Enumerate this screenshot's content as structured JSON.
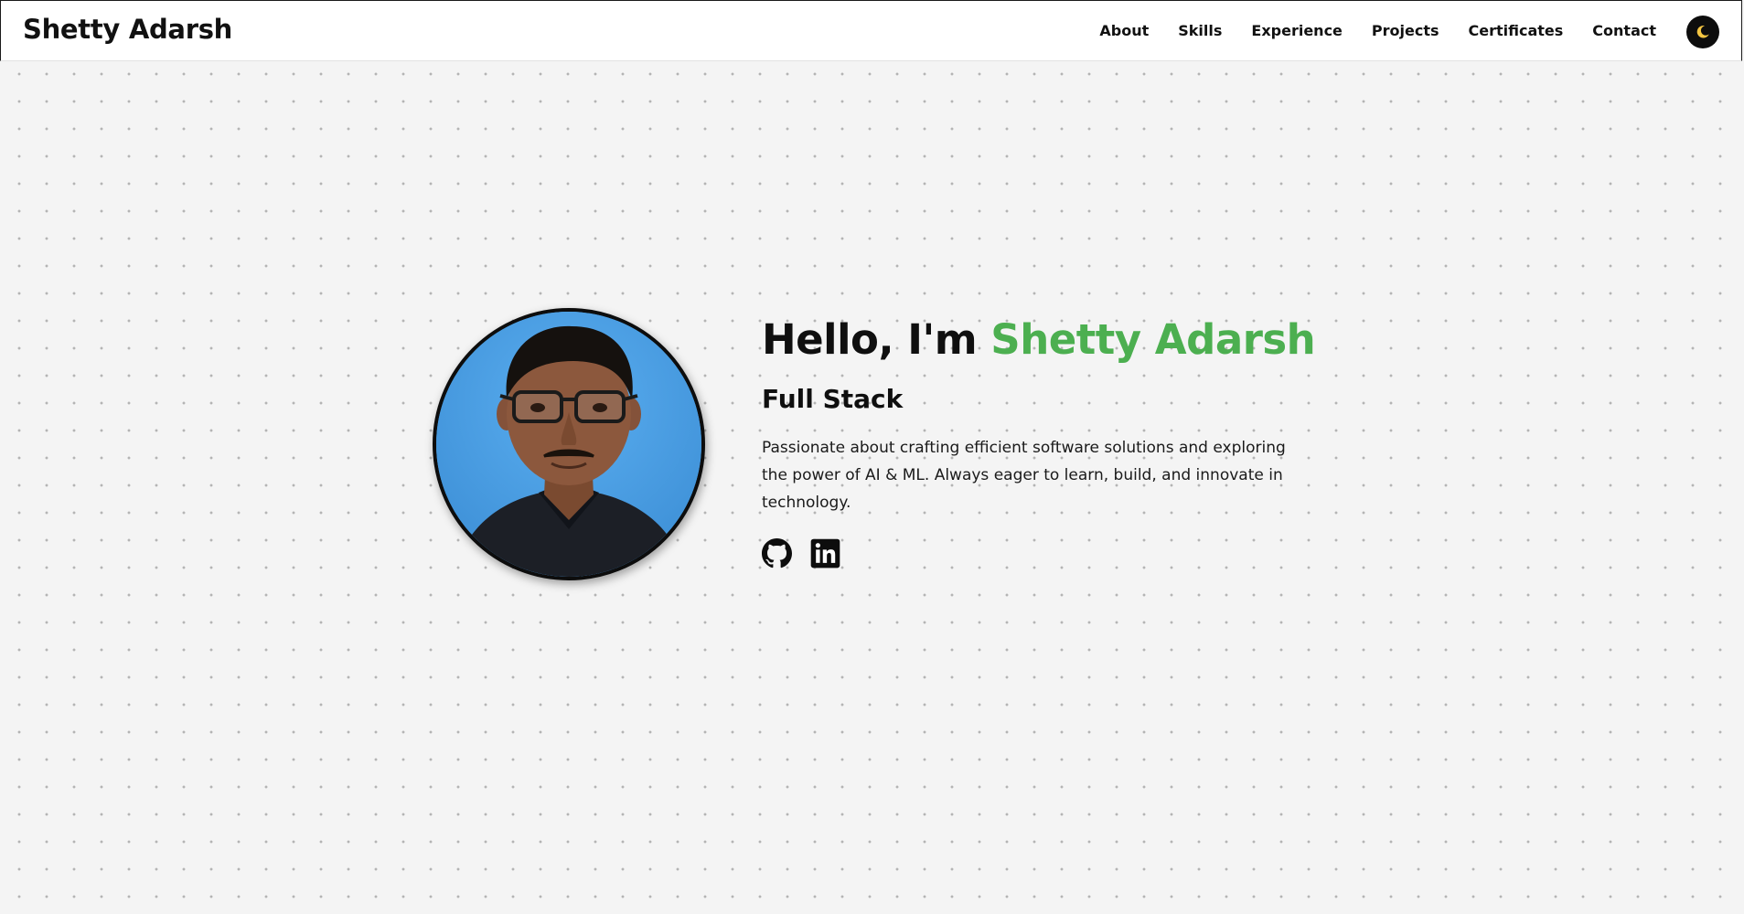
{
  "header": {
    "brand": "Shetty Adarsh",
    "nav": [
      "About",
      "Skills",
      "Experience",
      "Projects",
      "Certificates",
      "Contact"
    ],
    "theme_toggle_icon": "moon-icon"
  },
  "hero": {
    "greeting_prefix": "Hello, I'm ",
    "name": "Shetty Adarsh",
    "role": "Full Stack",
    "bio": "Passionate about crafting efficient software solutions and exploring the power of AI & ML. Always eager to learn, build, and innovate in technology.",
    "socials": [
      "github-icon",
      "linkedin-icon"
    ]
  },
  "colors": {
    "accent": "#4caf50",
    "page_background": "#f4f4f4",
    "text": "#0f0f0f",
    "toggle_background": "#0d0d0d",
    "moon": "#f4c542"
  }
}
